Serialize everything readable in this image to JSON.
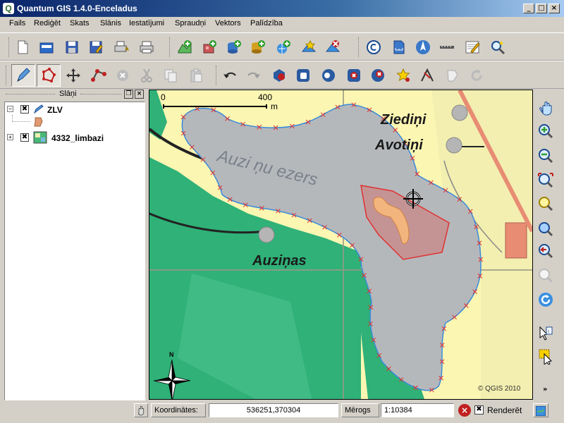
{
  "window": {
    "title": "Quantum GIS 1.4.0-Enceladus",
    "app_icon_letter": "Q"
  },
  "menu": [
    "Fails",
    "Rediģēt",
    "Skats",
    "Slānis",
    "Iestatījumi",
    "Spraudņi",
    "Vektors",
    "Palīdzība"
  ],
  "toolbar1": [
    "new-project-icon",
    "open-project-icon",
    "save-project-icon",
    "save-as-icon",
    "print-composer-icon",
    "print-icon",
    "add-vector-layer-icon",
    "add-raster-layer-icon",
    "add-postgis-layer-icon",
    "add-spatialite-layer-icon",
    "add-wms-layer-icon",
    "new-vector-layer-icon",
    "remove-layer-icon",
    "copyright-label-icon",
    "scale-bar-icon",
    "north-arrow-icon",
    "measure-line-icon",
    "annotation-icon",
    "identify-features-icon"
  ],
  "toolbar2": [
    "toggle-editing-icon",
    "capture-polygon-icon",
    "move-feature-icon",
    "node-tool-icon",
    "delete-selected-icon",
    "cut-features-icon",
    "copy-features-icon",
    "paste-features-icon",
    "undo-icon",
    "redo-icon",
    "simplify-feature-icon",
    "add-ring-icon",
    "add-island-icon",
    "delete-ring-icon",
    "delete-part-icon",
    "reshape-features-icon",
    "split-features-icon",
    "merge-features-icon",
    "rotate-icon"
  ],
  "layers": {
    "title": "Slāņi",
    "items": [
      {
        "name": "ZLV",
        "checked": "✖",
        "expanded": "−"
      },
      {
        "name": "4332_limbazi",
        "checked": "✖",
        "expanded": "+"
      }
    ]
  },
  "map": {
    "scalebar": {
      "start": "0",
      "end": "400",
      "unit": "m"
    },
    "labels": {
      "lake": "Auzi  ņu  ezers",
      "place1": "Ziediņi",
      "place2": "Avotiņi",
      "place3": "Auziņas"
    },
    "copyright": "© QGIS 2010"
  },
  "right_toolbar": [
    "pan-icon",
    "zoom-in-icon",
    "zoom-out-icon",
    "zoom-full-icon",
    "zoom-layer-icon",
    "zoom-selection-icon",
    "zoom-last-icon",
    "zoom-next-icon",
    "refresh-icon",
    "identify-icon",
    "select-features-icon",
    "more-chevron-icon"
  ],
  "status": {
    "coords_label": "Koordinātes:",
    "coords_value": "536251,370304",
    "scale_label": "Mērogs",
    "scale_value": "1:10384",
    "render_label": "Renderēt",
    "render_checked": "✖"
  },
  "colors": {
    "water": "#b5b8bb",
    "forest": "#2fb178",
    "field": "#fbf6b2",
    "sketch": "#e05050",
    "selection": "#f3b57e"
  }
}
